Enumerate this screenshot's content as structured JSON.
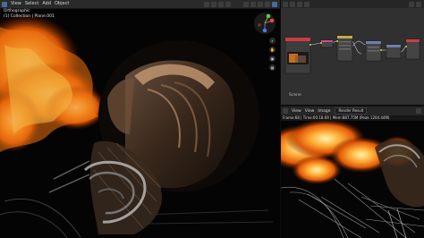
{
  "viewport": {
    "menu": [
      "View",
      "Select",
      "Add",
      "Object"
    ],
    "info_line1": "Orthographic",
    "info_line2": "(1) Collection | Plane.001",
    "tools": [
      "zoom-icon",
      "hand-icon",
      "camera-icon",
      "grid-icon"
    ]
  },
  "node_editor": {
    "scene_label": "Scene"
  },
  "image_editor": {
    "menu": [
      "View",
      "View",
      "Image"
    ],
    "image_name": "Render Result",
    "info": "Frame:68 | Time:00:18.69 | Mem:887.75M (Peak 1204.44M)"
  },
  "colors": {
    "fire_core": "#ffe08a",
    "fire_mid": "#ff8a1a",
    "fire_edge": "#b83a00",
    "metal": "#7a5a40",
    "panel": "#303030"
  }
}
